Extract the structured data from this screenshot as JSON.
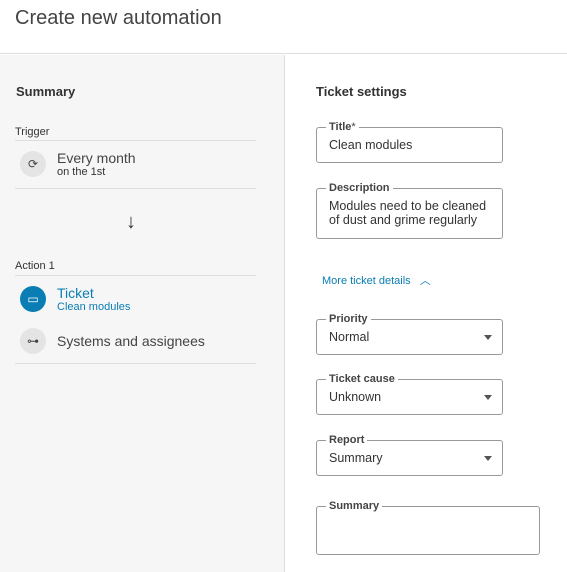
{
  "header": {
    "title": "Create new automation"
  },
  "summary": {
    "title": "Summary",
    "trigger_label": "Trigger",
    "trigger": {
      "title": "Every month",
      "subtitle": "on the 1st",
      "icon": "refresh-icon"
    },
    "action_label": "Action 1",
    "ticket": {
      "title": "Ticket",
      "subtitle": "Clean modules",
      "icon": "ticket-icon"
    },
    "systems": {
      "title": "Systems and assignees",
      "icon": "hierarchy-icon"
    },
    "accent": "#0a7db4"
  },
  "settings": {
    "title": "Ticket settings",
    "title_field": {
      "label": "Title",
      "required": "*",
      "value": "Clean modules"
    },
    "description": {
      "label": "Description",
      "value": "Modules need to be cleaned of dust and grime regularly"
    },
    "more_details": "More ticket details",
    "priority": {
      "label": "Priority",
      "value": "Normal"
    },
    "cause": {
      "label": "Ticket cause",
      "value": "Unknown"
    },
    "report": {
      "label": "Report",
      "value": "Summary"
    },
    "summary_field": {
      "label": "Summary",
      "value": ""
    }
  }
}
